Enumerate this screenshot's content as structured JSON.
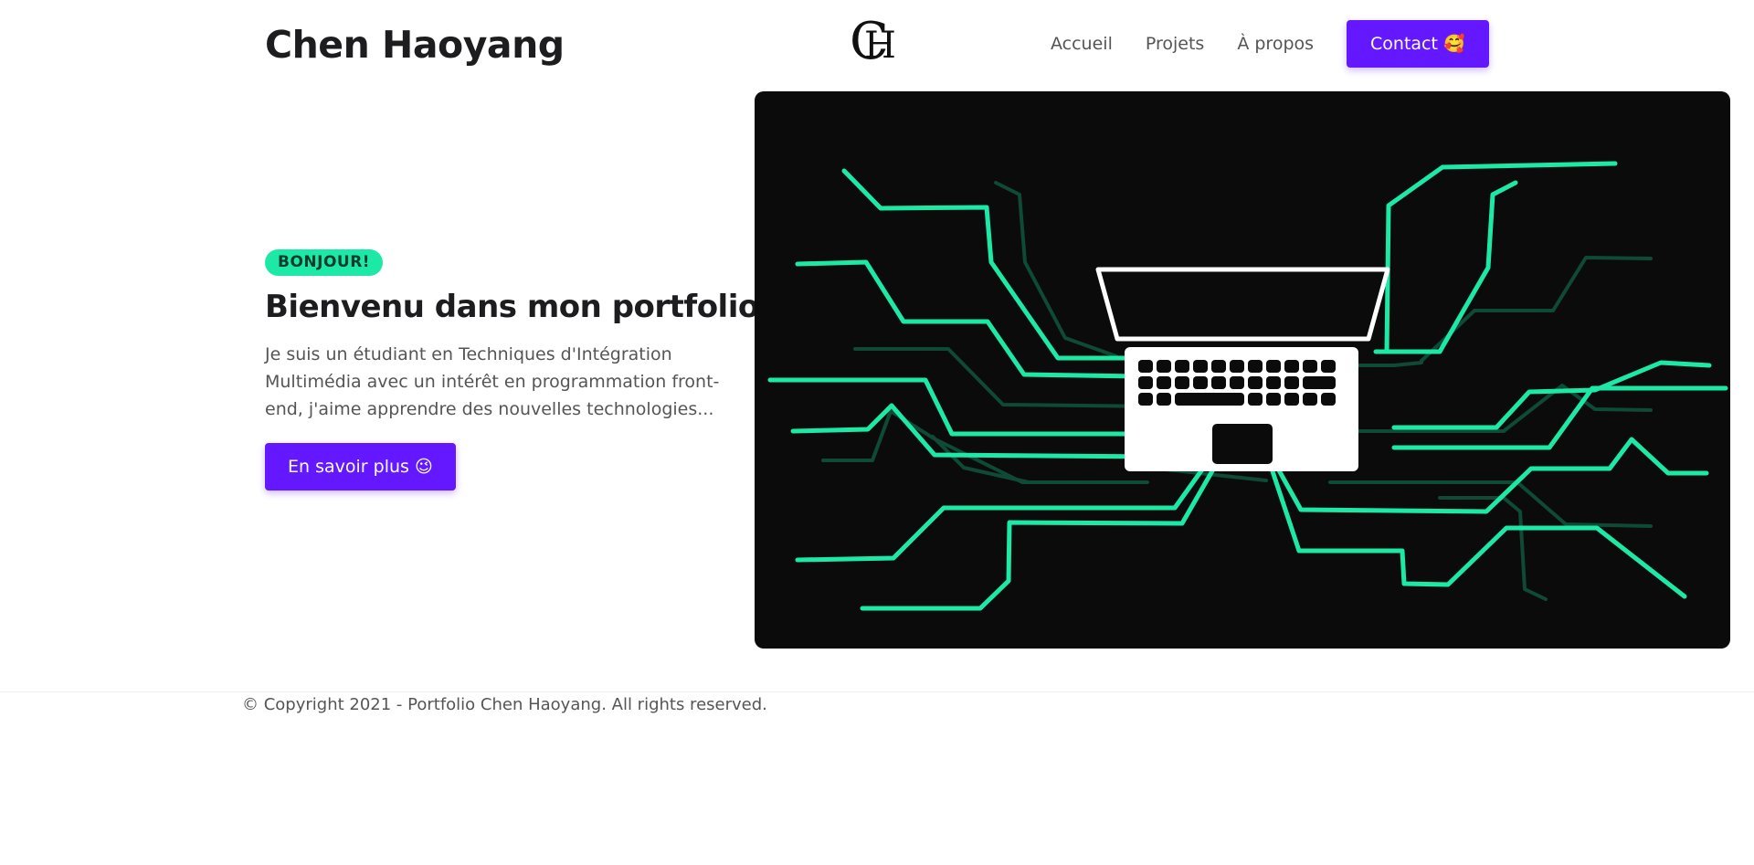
{
  "header": {
    "site_title": "Chen Haoyang",
    "logo_letters": {
      "c": "C",
      "h": "H"
    },
    "nav": [
      {
        "label": "Accueil"
      },
      {
        "label": "Projets"
      },
      {
        "label": "À propos"
      }
    ],
    "contact_label": "Contact 🥰"
  },
  "hero": {
    "badge": "BONJOUR!",
    "heading": "Bienvenu dans mon portfolio!",
    "text": "Je suis un étudiant en Techniques d'Intégration Multimédia avec un intérêt en programmation front-end, j'aime apprendre des nouvelles technologies...",
    "cta_label": "En savoir plus 😉"
  },
  "illustration": {
    "icon": "laptop-circuit-icon",
    "colors": {
      "background": "#0b0b0b",
      "circuit_bright": "#1de9a6",
      "circuit_dim": "#0e4a35",
      "laptop": "#ffffff"
    }
  },
  "footer": {
    "copyright": "© Copyright 2021 - Portfolio Chen Haoyang. All rights reserved."
  },
  "colors": {
    "accent": "#6418ff",
    "badge": "#1de9a6",
    "text_dark": "#1d1d1f",
    "text_muted": "#555555"
  }
}
